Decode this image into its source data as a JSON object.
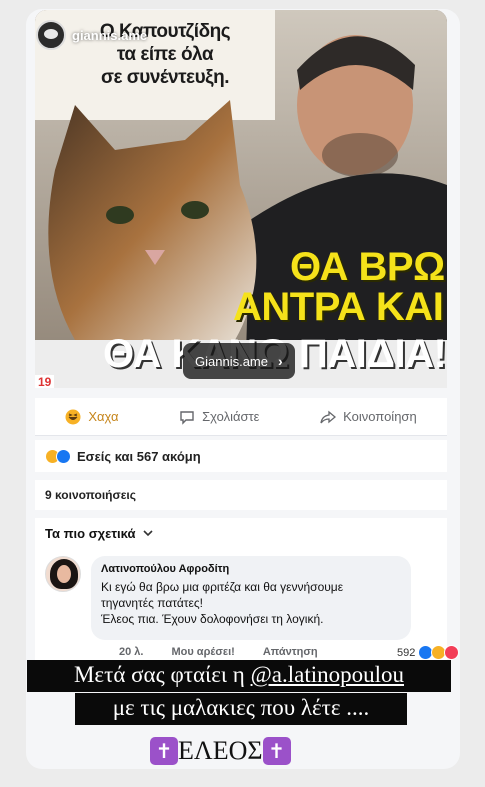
{
  "story": {
    "username": "giannis.ame",
    "profile_pill_label": "Giannis.ame"
  },
  "meme": {
    "top_caption_lines": [
      "Ο Καπουτζίδης",
      "τα είπε όλα",
      "σε συνέντευξη."
    ],
    "yellow_line1": "ΘΑ ΒΡΩ",
    "yellow_line2": "ΑΝΤΡΑ ΚΑΙ",
    "white_line": "ΘΑ ΚΑΝΩ ΠΑΙΔΙΑ!",
    "corner_number": "19"
  },
  "post_actions": [
    {
      "label": "Χαχα",
      "icon": "haha-icon"
    },
    {
      "label": "Σχολιάστε",
      "icon": "comment-icon"
    },
    {
      "label": "Κοινοποίηση",
      "icon": "share-icon"
    }
  ],
  "reactions": {
    "summary": "Εσείς και 567 ακόμη",
    "colors": {
      "haha": "#f7b125",
      "like": "#1877f2",
      "love": "#f33e58"
    }
  },
  "shares_label": "9 κοινοποιήσεις",
  "sort_label": "Τα πιο σχετικά",
  "comment": {
    "author": "Λατινοπούλου Αφροδίτη",
    "lines": [
      "Κι εγώ θα βρω μια φριτέζα και θα γεννήσουμε",
      "τηγανητές πατάτες!",
      "Έλεος πια. Έχουν δολοφονήσει τη λογική."
    ],
    "time": "20 λ.",
    "like_action": "Μου αρέσει!",
    "reply_action": "Απάντηση",
    "reaction_count": "592"
  },
  "overlay": {
    "line1_prefix": "Μετά σας φταίει η ",
    "line1_mention": "@a.latinopoulou",
    "line2": "με τις μαλακιες που λέτε ....",
    "eleos": "ΕΛΕΟΣ",
    "cross_glyph": "✝"
  }
}
